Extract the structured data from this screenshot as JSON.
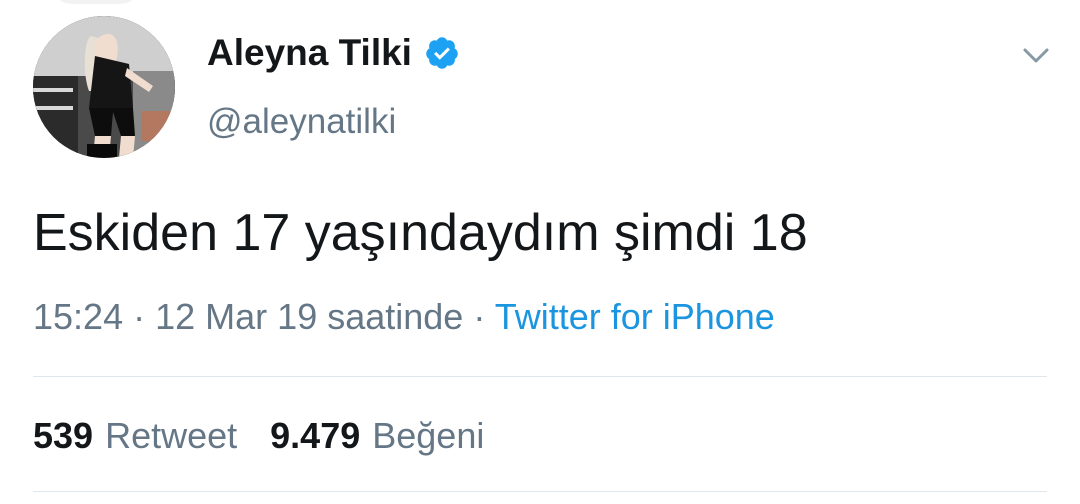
{
  "user": {
    "display_name": "Aleyna Tilki",
    "handle": "@aleynatilki",
    "verified": true,
    "avatar_icon": "profile-photo"
  },
  "tweet": {
    "text": "Eskiden 17 yaşındaydım şimdi 18",
    "time": "15:24",
    "date": "12 Mar 19 saatinde",
    "separator": "·",
    "source": "Twitter for iPhone"
  },
  "stats": {
    "retweet_count": "539",
    "retweet_label": "Retweet",
    "like_count": "9.479",
    "like_label": "Beğeni"
  },
  "icons": {
    "verified": "verified-badge-icon",
    "menu": "chevron-down-icon"
  },
  "colors": {
    "verified_blue": "#1da1f2",
    "link_blue": "#1b95e0",
    "secondary_text": "#657786",
    "primary_text": "#14171a",
    "divider": "#e1e8ed"
  }
}
